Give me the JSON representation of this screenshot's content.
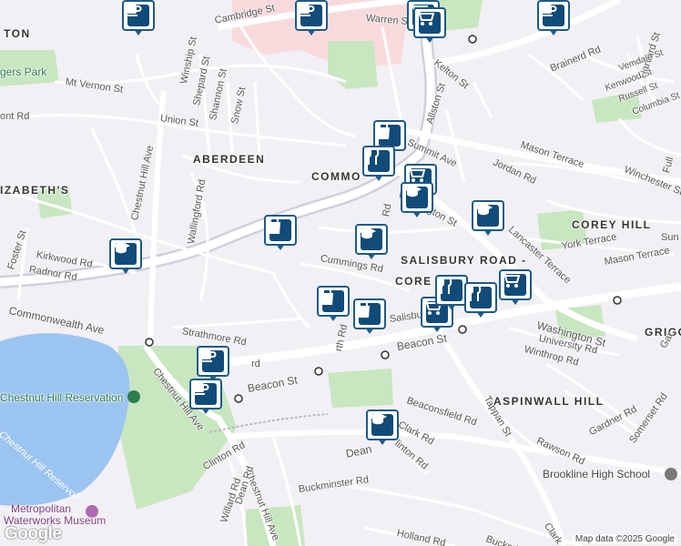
{
  "map": {
    "labels": {
      "cambridge_st": "Cambridge St",
      "warren_st": "Warren St",
      "kelton_st": "Kelton St",
      "brainerd_rd": "Brainerd Rd",
      "harvard_st": "Harvard St",
      "vemdale_st": "Vemdale St",
      "kenwood_st": "Kenwood St",
      "russell_st": "Russell St",
      "columbia_st": "Columbia St",
      "allston_st": "Allston St",
      "summit_ave": "Summit Ave",
      "mason_terrace_n": "Mason Terrace",
      "jordan_rd": "Jordan Rd",
      "winchester_st": "Winchester St",
      "corey_hill": "COREY HILL",
      "york_terrace": "York Terrace",
      "mason_terrace_s": "Mason Terrace",
      "lancaster_terrace": "Lancaster Terrace",
      "washington_st_n": "Washington St",
      "washington_st_s": "Washington St",
      "salisbury_road": "SALISBURY ROAD -",
      "corey_rd": "CORE",
      "salisbury_rd": "Salisbury",
      "university_rd": "University Rd",
      "winthrop_rd": "Winthrop Rd",
      "grigg": "GRIGG",
      "aspinwall_hill": "ASPINWALL HILL",
      "beacon_st_e": "Beacon St",
      "beacon_st_w": "Beacon St",
      "beaconsfield_rd": "Beaconsfield Rd",
      "clark_rd": "Clark Rd",
      "tappan_st": "Tappan St",
      "rawson_rd": "Rawson Rd",
      "gardner_rd": "Gardner Rd",
      "somerset_rd": "Somerset Rd",
      "brookline_high": "Brookline High School",
      "dean_rd": "Dean",
      "clinton_rd_e": "linton Rd",
      "buckminster_rd": "Buckminster Rd",
      "buckminster_e": "Buckmins",
      "holland_rd": "Holland Rd",
      "clark_rd_s": "Clark",
      "chestnut_hill_ave_s": "Chestnut Hill Ave",
      "dean_rd_s": "Dean Rd",
      "willard_rd": "Willard Rd",
      "clinton_rd_w": "Clinton Rd",
      "metropolitan": "Metropolitan",
      "waterworks": "Waterworks Museum",
      "chestnut_hill_reservation": "Chestnut Hill Reservation",
      "chestnut_hill_reservoir": "Chestnut Hill Reservoir",
      "chestnut_hill_ave_w": "Chestnut Hill Ave",
      "commonwealth_ave": "Commonwealth Ave",
      "strathmore_rd": "Strathmore Rd",
      "ayth_rd": "rth Rd",
      "cummings_rd": "Cummings Rd",
      "aberdeen": "ABERDEEN",
      "commonwealth": "COMMO",
      "elizabeths": "IZABETH'S",
      "wallingford_rd": "Wallingford Rd",
      "foster_st": "Foster St",
      "kirkwood_rd": "Kirkwood Rd",
      "radnor_rd": "Radnor Rd",
      "chestnut_hill_ave_n": "Chestnut Hill Ave",
      "mt_vernon_st": "Mt Vernon St",
      "union_st": "Union St",
      "winship_st": "Winship St",
      "shepard_st": "Shepard St",
      "shannon_st": "Shannon St",
      "snow_st": "Snow St",
      "rogers_park": "gers Park",
      "brighton": "TON",
      "front_rd": "ont Rd",
      "sun": "Sun",
      "gar": "Gar",
      "full": "Full",
      "rd_stub": "rd",
      "rd2": "Rd"
    },
    "pins": [
      {
        "kind": "cafe",
        "icon": "coffee-cup-icon"
      },
      {
        "kind": "cafe",
        "icon": "coffee-cup-icon"
      },
      {
        "kind": "grocery",
        "icon": "shopping-cart-icon"
      },
      {
        "kind": "grocery",
        "icon": "shopping-cart-icon"
      },
      {
        "kind": "cafe",
        "icon": "coffee-cup-icon"
      },
      {
        "kind": "shop",
        "icon": "shopping-bag-icon"
      },
      {
        "kind": "restaurant",
        "icon": "fork-knife-icon"
      },
      {
        "kind": "grocery",
        "icon": "shopping-cart-icon"
      },
      {
        "kind": "school",
        "icon": "graduation-cap-icon"
      },
      {
        "kind": "school",
        "icon": "graduation-cap-icon"
      },
      {
        "kind": "shop",
        "icon": "shopping-bag-icon"
      },
      {
        "kind": "school",
        "icon": "graduation-cap-icon"
      },
      {
        "kind": "school",
        "icon": "graduation-cap-icon"
      },
      {
        "kind": "shop",
        "icon": "shopping-bag-icon"
      },
      {
        "kind": "shop",
        "icon": "shopping-bag-icon"
      },
      {
        "kind": "grocery",
        "icon": "shopping-cart-icon"
      },
      {
        "kind": "restaurant",
        "icon": "fork-knife-icon"
      },
      {
        "kind": "restaurant",
        "icon": "fork-knife-icon"
      },
      {
        "kind": "grocery",
        "icon": "shopping-cart-icon"
      },
      {
        "kind": "cafe",
        "icon": "coffee-cup-icon"
      },
      {
        "kind": "cafe",
        "icon": "coffee-cup-icon"
      },
      {
        "kind": "school",
        "icon": "graduation-cap-icon"
      }
    ]
  },
  "attribution": "Map data ©2025 Google",
  "logo": "Google",
  "colors": {
    "background": "#f2f0f4",
    "park": "#c8e6c0",
    "water": "#9cc4f0",
    "road": "#ffffff",
    "highway": "#cfd0db",
    "campus": "#f9dadc",
    "pin_border": "#1d5a87",
    "pin_icon": "#114b78"
  }
}
